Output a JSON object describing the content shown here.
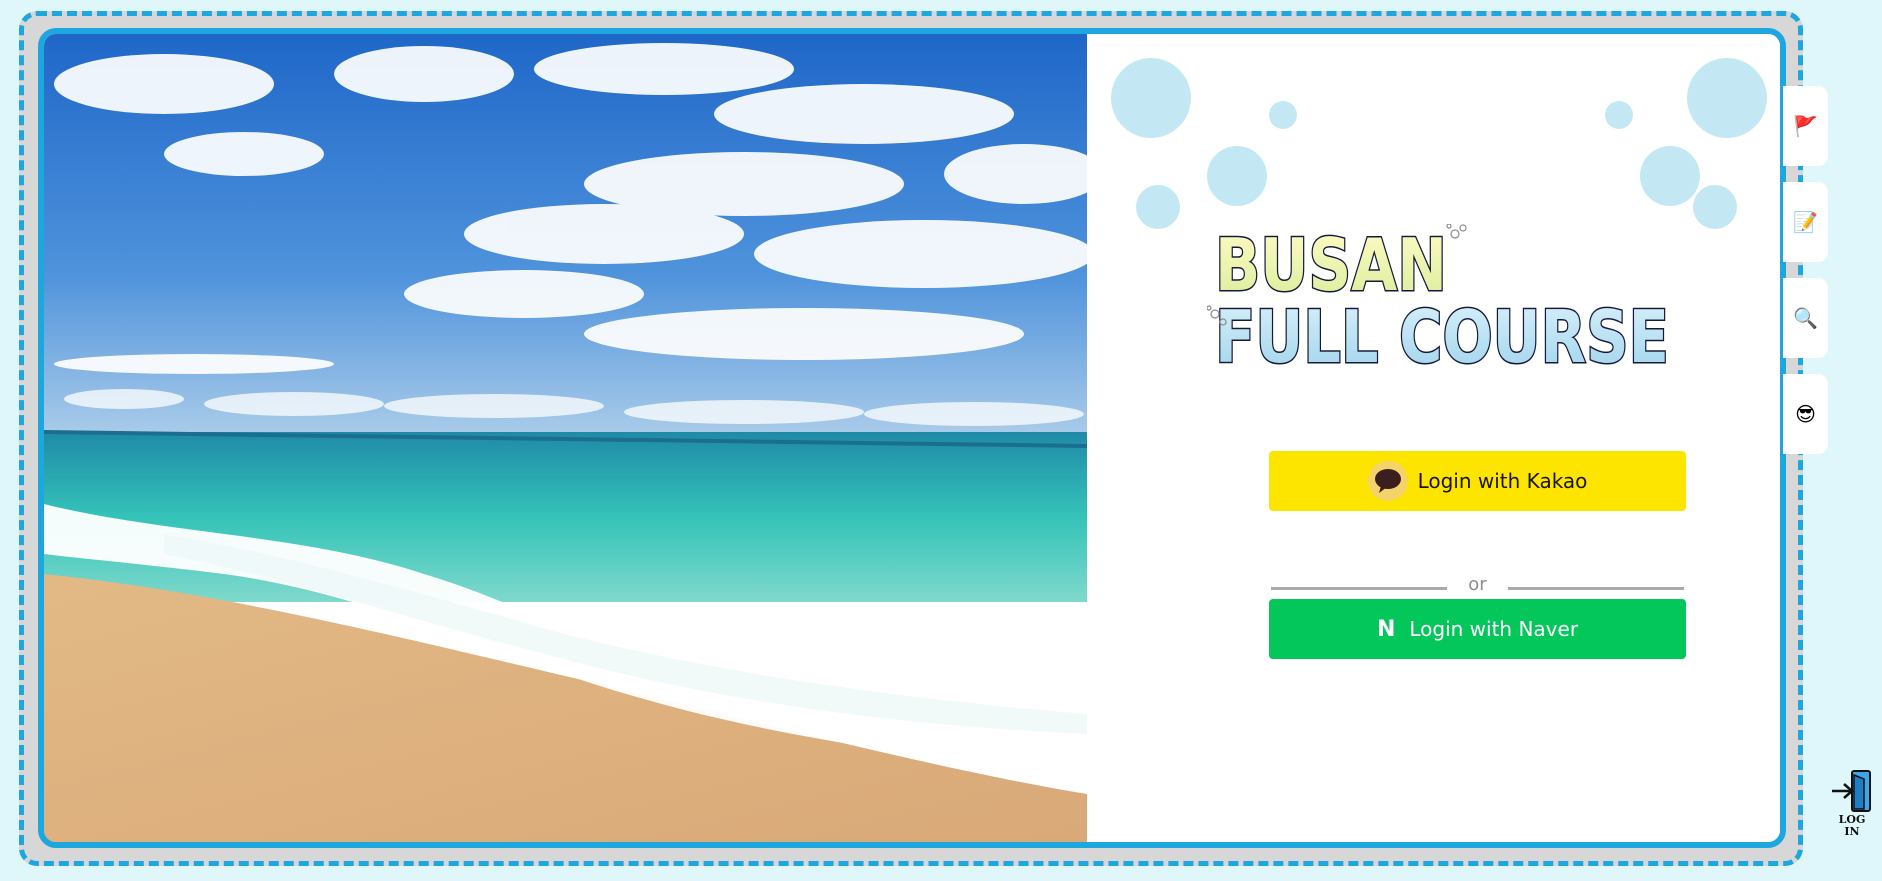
{
  "brand": {
    "logo_line1": "BUSAN",
    "logo_line2": "FULL COURSE"
  },
  "login": {
    "kakao_label": "Login with Kakao",
    "naver_label": "Login with Naver",
    "naver_mark": "N",
    "divider_text": "or"
  },
  "side_tabs": [
    {
      "icon": "flag-icon",
      "glyph": "🚩"
    },
    {
      "icon": "memo-icon",
      "glyph": "📝"
    },
    {
      "icon": "search-icon",
      "glyph": "🔍"
    },
    {
      "icon": "sunglasses-face-icon",
      "glyph": "😎"
    }
  ],
  "login_link": {
    "icon": "door-enter-icon",
    "label": "LOG IN"
  },
  "colors": {
    "accent": "#1ea6df",
    "kakao": "#fee500",
    "naver": "#03c75a",
    "bubble": "#c4e8f3",
    "background": "#dff6fb"
  }
}
